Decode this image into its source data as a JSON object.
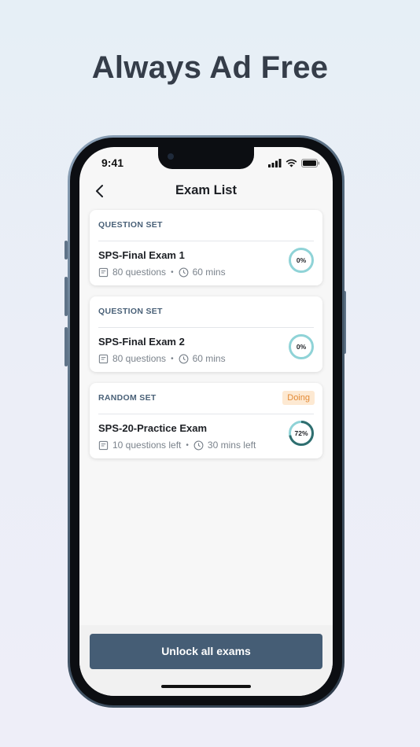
{
  "headline": "Always Ad Free",
  "status_bar": {
    "time": "9:41"
  },
  "nav": {
    "title": "Exam List"
  },
  "cards": [
    {
      "set_type": "QUESTION SET",
      "exam_name": "SPS-Final Exam 1",
      "questions": "80 questions",
      "duration": "60 mins",
      "progress_label": "0%",
      "progress_value": 0
    },
    {
      "set_type": "QUESTION SET",
      "exam_name": "SPS-Final Exam 2",
      "questions": "80 questions",
      "duration": "60 mins",
      "progress_label": "0%",
      "progress_value": 0
    },
    {
      "set_type": "RANDOM SET",
      "badge": "Doing",
      "exam_name": "SPS-20-Practice Exam",
      "questions": "10 questions left",
      "duration": "30 mins left",
      "progress_label": "72%",
      "progress_value": 72
    }
  ],
  "unlock_button": "Unlock all exams",
  "colors": {
    "accent": "#455d75",
    "progress_ring": "#8fd3d7",
    "progress_fill": "#2f6e6f",
    "badge_bg": "#fde9d2",
    "badge_text": "#e38a36"
  }
}
